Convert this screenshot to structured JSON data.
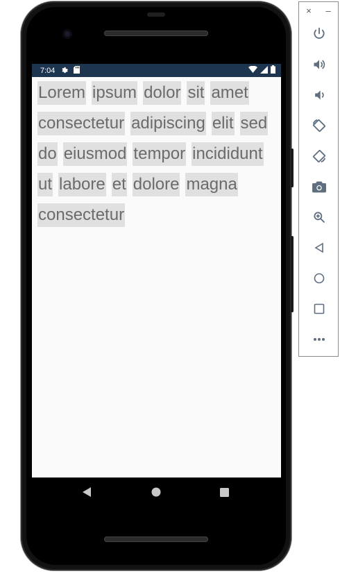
{
  "status_bar": {
    "time": "7:04",
    "bg_color": "#1e3550"
  },
  "chips": [
    "Lorem",
    "ipsum",
    "dolor",
    "sit",
    "amet",
    "consectetur",
    "adipiscing",
    "elit",
    "sed",
    "do",
    "eiusmod",
    "tempor",
    "incididunt",
    "ut",
    "labore",
    "et",
    "dolore",
    "magna",
    "consectetur"
  ],
  "nav": {
    "icons": [
      "back-icon",
      "home-icon",
      "recents-icon"
    ]
  },
  "toolbar": {
    "close": "×",
    "minimize": "–",
    "buttons": [
      "power-icon",
      "volume-up-icon",
      "volume-down-icon",
      "rotate-left-icon",
      "rotate-right-icon",
      "camera-icon",
      "zoom-icon",
      "back-icon",
      "home-icon",
      "overview-icon",
      "more-icon"
    ]
  },
  "colors": {
    "chip_bg": "#e0e0e0",
    "chip_text": "#6b6b6b",
    "screen_bg": "#fafafa"
  }
}
